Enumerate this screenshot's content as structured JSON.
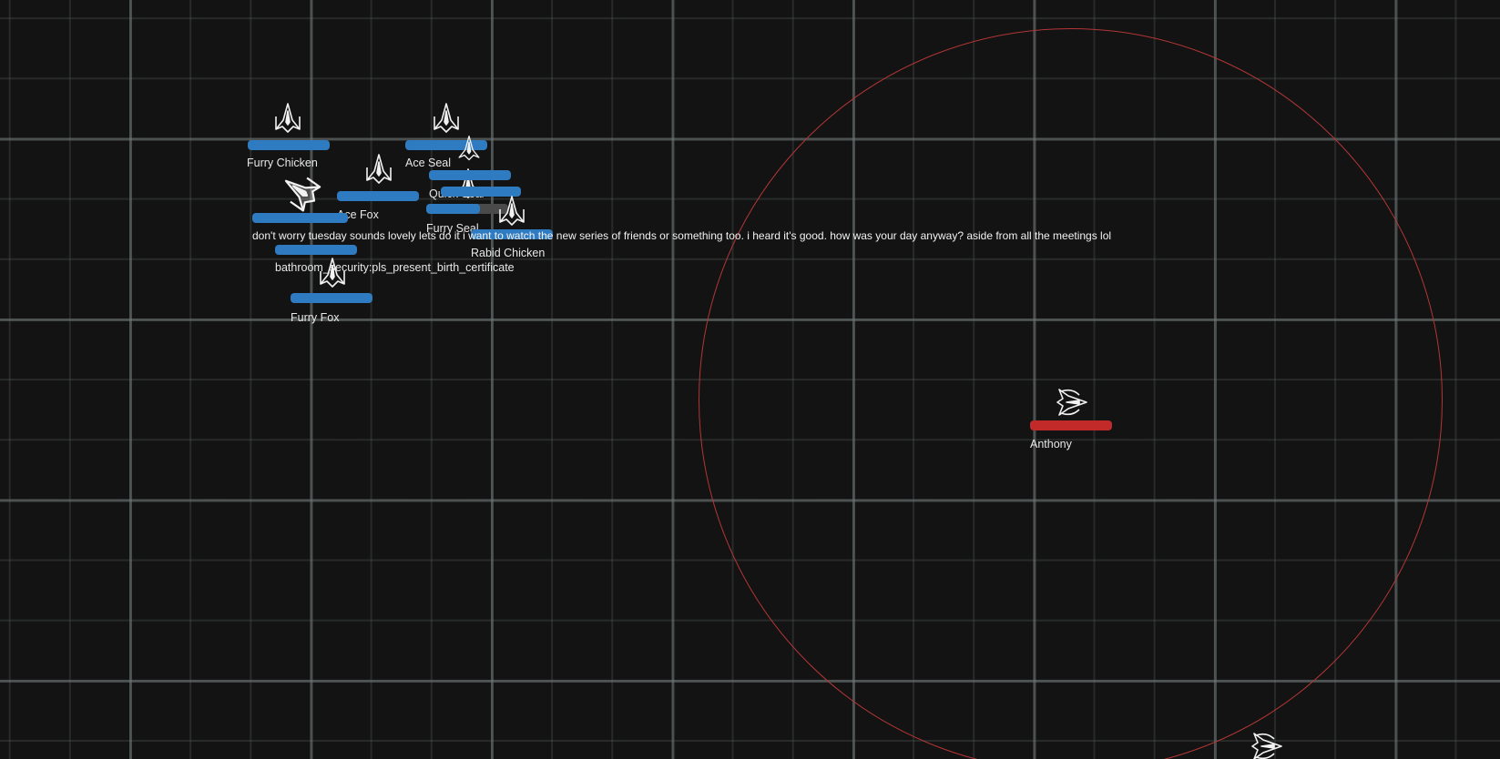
{
  "colors": {
    "ally_bar": "#2f7bc2",
    "enemy_bar": "#c22a2a",
    "range_circle": "#b33636",
    "background": "#131313"
  },
  "player": {
    "name": "Anthony",
    "health": 1.0
  },
  "allies": [
    {
      "key": "furry-chicken",
      "name": "Furry Chicken",
      "health": 1.0
    },
    {
      "key": "ace-seal",
      "name": "Ace Seal",
      "health": 1.0
    },
    {
      "key": "ace-fox",
      "name": "Ace Fox",
      "health": 1.0
    },
    {
      "key": "quick-seal",
      "name": "Quick Seal",
      "health": 1.0
    },
    {
      "key": "furry-seal",
      "name": "Furry Seal",
      "health": 0.65
    },
    {
      "key": "rabid-chicken",
      "name": "Rabid Chicken",
      "health": 1.0
    },
    {
      "key": "bathroom-security",
      "name": "bathroom_security:pls_present_birth_certificate",
      "health": 1.0
    },
    {
      "key": "furry-fox",
      "name": "Furry Fox",
      "health": 1.0
    }
  ],
  "chat_message": "don't worry tuesday sounds lovely lets do it i want to watch the new series of friends or something too. i heard it's good. how was your day anyway? aside from all the meetings lol",
  "icons": {
    "ally_ship": "fighter-ship-icon",
    "player_ship": "player-ship-icon"
  }
}
